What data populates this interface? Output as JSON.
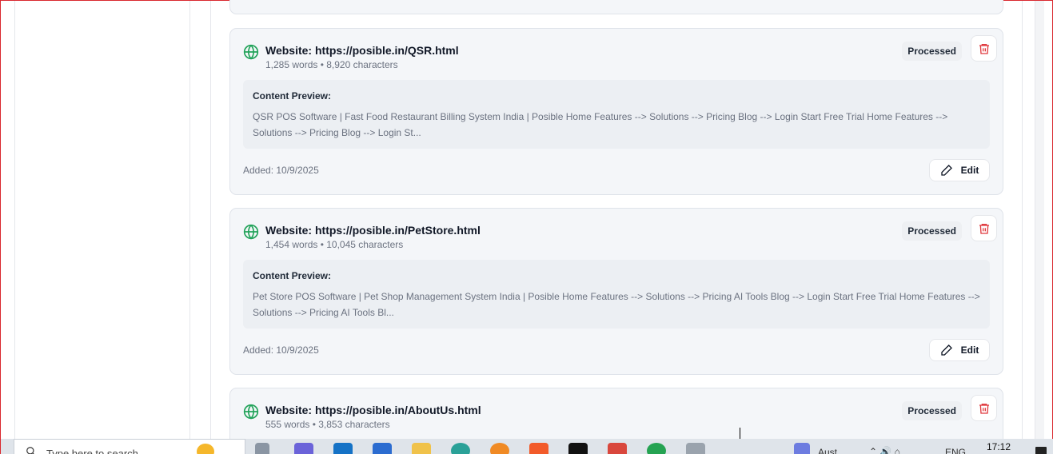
{
  "cards": [
    {
      "title": "Website: https://posible.in/QSR.html",
      "meta": "1,285 words • 8,920 characters",
      "status": "Processed",
      "preview_label": "Content Preview:",
      "preview_text": "QSR POS Software | Fast Food Restaurant Billing System India | Posible Home Features --> Solutions --> Pricing Blog --> Login Start Free Trial Home Features --> Solutions --> Pricing Blog --> Login St...",
      "added": "Added: 10/9/2025",
      "edit_label": "Edit"
    },
    {
      "title": "Website: https://posible.in/PetStore.html",
      "meta": "1,454 words • 10,045 characters",
      "status": "Processed",
      "preview_label": "Content Preview:",
      "preview_text": "Pet Store POS Software | Pet Shop Management System India | Posible Home Features --> Solutions --> Pricing AI Tools Blog --> Login Start Free Trial Home Features --> Solutions --> Pricing AI Tools Bl...",
      "added": "Added: 10/9/2025",
      "edit_label": "Edit"
    },
    {
      "title": "Website: https://posible.in/AboutUs.html",
      "meta": "555 words • 3,853 characters",
      "status": "Processed"
    }
  ],
  "icons": {
    "globe": "globe-icon",
    "delete": "trash-icon",
    "edit": "pencil-icon"
  },
  "colors": {
    "globe": "#22a35a",
    "delete": "#e0393e",
    "card_bg": "#f4f6f9",
    "preview_bg": "#eceff3"
  },
  "taskbar": {
    "search_placeholder": "Type here to search",
    "weather_text": "Aust",
    "language": "ENG",
    "time": "17:12"
  }
}
